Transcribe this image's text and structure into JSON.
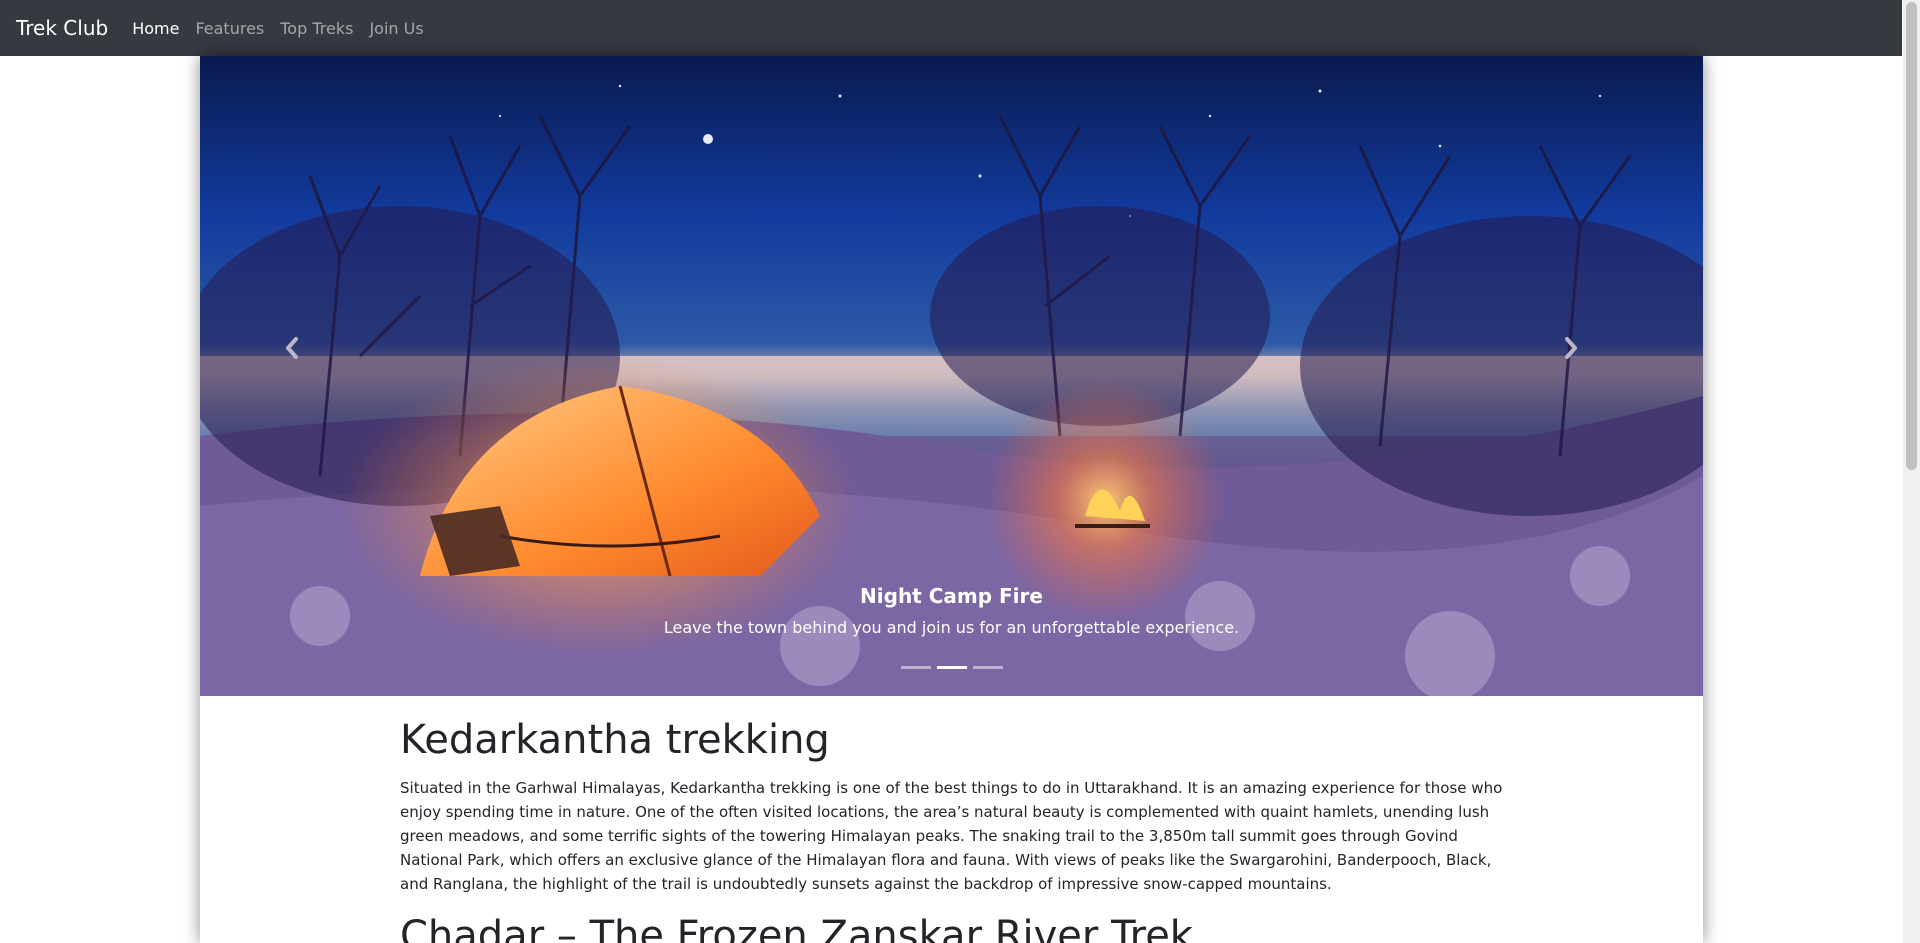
{
  "navbar": {
    "brand": "Trek Club",
    "links": [
      "Home",
      "Features",
      "Top Treks",
      "Join Us"
    ],
    "active_index": 0
  },
  "carousel": {
    "caption_title": "Night Camp Fire",
    "caption_text": "Leave the town behind you and join us for an unforgettable experience.",
    "slides_count": 3,
    "active_slide": 2
  },
  "content": {
    "heading1": "Kedarkantha trekking",
    "paragraph1": "Situated in the Garhwal Himalayas, Kedarkantha trekking is one of the best things to do in Uttarakhand. It is an amazing experience for those who enjoy spending time in nature. One of the often visited locations, the area’s natural beauty is complemented with quaint hamlets, unending lush green meadows, and some terrific sights of the towering Himalayan peaks. The snaking trail to the 3,850m tall summit goes through Govind National Park, which offers an exclusive glance of the Himalayan flora and fauna. With views of peaks like the Swargarohini, Banderpooch, Black, and Ranglana, the highlight of the trail is undoubtedly sunsets against the backdrop of impressive snow-capped mountains.",
    "heading2": "Chadar – The Frozen Zanskar River Trek"
  }
}
